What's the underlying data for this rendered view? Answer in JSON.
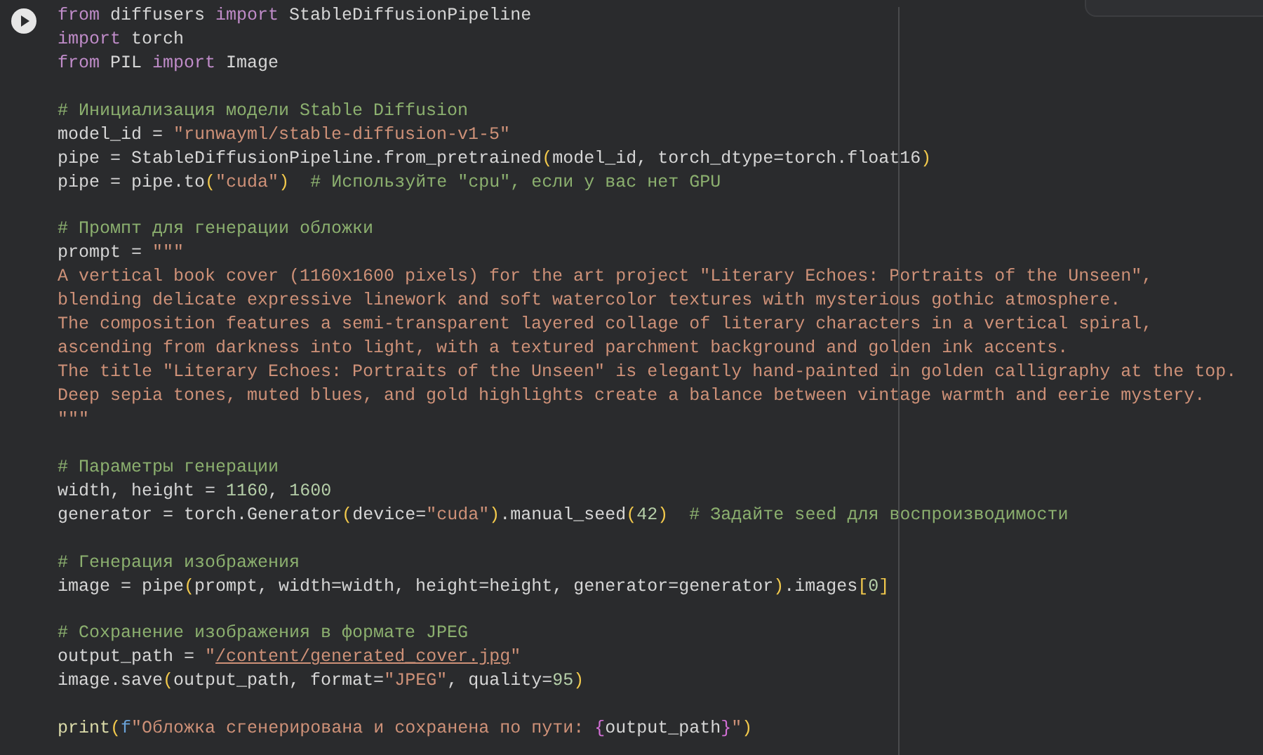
{
  "code_cell": {
    "lines": [
      {
        "kind": "code",
        "tokens": [
          {
            "kind": "keyword",
            "text": "from"
          },
          {
            "kind": "plain",
            "text": " diffusers "
          },
          {
            "kind": "keyword",
            "text": "import"
          },
          {
            "kind": "plain",
            "text": " StableDiffusionPipeline"
          }
        ]
      },
      {
        "kind": "code",
        "tokens": [
          {
            "kind": "keyword",
            "text": "import"
          },
          {
            "kind": "plain",
            "text": " torch"
          }
        ]
      },
      {
        "kind": "code",
        "tokens": [
          {
            "kind": "keyword",
            "text": "from"
          },
          {
            "kind": "plain",
            "text": " PIL "
          },
          {
            "kind": "keyword",
            "text": "import"
          },
          {
            "kind": "plain",
            "text": " Image"
          }
        ]
      },
      {
        "kind": "blank"
      },
      {
        "kind": "code",
        "tokens": [
          {
            "kind": "comment",
            "text": "# Инициализация модели Stable Diffusion"
          }
        ]
      },
      {
        "kind": "code",
        "tokens": [
          {
            "kind": "plain",
            "text": "model_id = "
          },
          {
            "kind": "string",
            "text": "\"runwayml/stable-diffusion-v1-5\""
          }
        ]
      },
      {
        "kind": "code",
        "tokens": [
          {
            "kind": "plain",
            "text": "pipe = StableDiffusionPipeline.from_pretrained"
          },
          {
            "kind": "bracket",
            "text": "("
          },
          {
            "kind": "plain",
            "text": "model_id, torch_dtype=torch.float16"
          },
          {
            "kind": "bracket",
            "text": ")"
          }
        ]
      },
      {
        "kind": "code",
        "tokens": [
          {
            "kind": "plain",
            "text": "pipe = pipe.to"
          },
          {
            "kind": "bracket",
            "text": "("
          },
          {
            "kind": "string",
            "text": "\"cuda\""
          },
          {
            "kind": "bracket",
            "text": ")"
          },
          {
            "kind": "comment",
            "text": "  # Используйте \"cpu\", если у вас нет GPU"
          }
        ]
      },
      {
        "kind": "blank"
      },
      {
        "kind": "code",
        "tokens": [
          {
            "kind": "comment",
            "text": "# Промпт для генерации обложки"
          }
        ]
      },
      {
        "kind": "code",
        "tokens": [
          {
            "kind": "plain",
            "text": "prompt = "
          },
          {
            "kind": "string",
            "text": "\"\"\""
          }
        ]
      },
      {
        "kind": "code",
        "tokens": [
          {
            "kind": "string",
            "text": "A vertical book cover (1160x1600 pixels) for the art project \"Literary Echoes: Portraits of the Unseen\","
          }
        ]
      },
      {
        "kind": "code",
        "tokens": [
          {
            "kind": "string",
            "text": "blending delicate expressive linework and soft watercolor textures with mysterious gothic atmosphere."
          }
        ]
      },
      {
        "kind": "code",
        "tokens": [
          {
            "kind": "string",
            "text": "The composition features a semi-transparent layered collage of literary characters in a vertical spiral,"
          }
        ]
      },
      {
        "kind": "code",
        "tokens": [
          {
            "kind": "string",
            "text": "ascending from darkness into light, with a textured parchment background and golden ink accents."
          }
        ]
      },
      {
        "kind": "code",
        "tokens": [
          {
            "kind": "string",
            "text": "The title \"Literary Echoes: Portraits of the Unseen\" is elegantly hand-painted in golden calligraphy at the top."
          }
        ]
      },
      {
        "kind": "code",
        "tokens": [
          {
            "kind": "string",
            "text": "Deep sepia tones, muted blues, and gold highlights create a balance between vintage warmth and eerie mystery."
          }
        ]
      },
      {
        "kind": "code",
        "tokens": [
          {
            "kind": "string",
            "text": "\"\"\""
          }
        ]
      },
      {
        "kind": "blank"
      },
      {
        "kind": "code",
        "tokens": [
          {
            "kind": "comment",
            "text": "# Параметры генерации"
          }
        ]
      },
      {
        "kind": "code",
        "tokens": [
          {
            "kind": "plain",
            "text": "width, height = "
          },
          {
            "kind": "number",
            "text": "1160"
          },
          {
            "kind": "plain",
            "text": ", "
          },
          {
            "kind": "number",
            "text": "1600"
          }
        ]
      },
      {
        "kind": "code",
        "tokens": [
          {
            "kind": "plain",
            "text": "generator = torch.Generator"
          },
          {
            "kind": "bracket",
            "text": "("
          },
          {
            "kind": "plain",
            "text": "device="
          },
          {
            "kind": "string",
            "text": "\"cuda\""
          },
          {
            "kind": "bracket",
            "text": ")"
          },
          {
            "kind": "plain",
            "text": ".manual_seed"
          },
          {
            "kind": "bracket",
            "text": "("
          },
          {
            "kind": "number",
            "text": "42"
          },
          {
            "kind": "bracket",
            "text": ")"
          },
          {
            "kind": "comment",
            "text": "  # Задайте seed для воспроизводимости"
          }
        ]
      },
      {
        "kind": "blank"
      },
      {
        "kind": "code",
        "tokens": [
          {
            "kind": "comment",
            "text": "# Генерация изображения"
          }
        ]
      },
      {
        "kind": "code",
        "tokens": [
          {
            "kind": "plain",
            "text": "image = pipe"
          },
          {
            "kind": "bracket",
            "text": "("
          },
          {
            "kind": "plain",
            "text": "prompt, width=width, height=height, generator=generator"
          },
          {
            "kind": "bracket",
            "text": ")"
          },
          {
            "kind": "plain",
            "text": ".images"
          },
          {
            "kind": "bracket",
            "text": "["
          },
          {
            "kind": "number",
            "text": "0"
          },
          {
            "kind": "bracket",
            "text": "]"
          }
        ]
      },
      {
        "kind": "blank"
      },
      {
        "kind": "code",
        "tokens": [
          {
            "kind": "comment",
            "text": "# Сохранение изображения в формате JPEG"
          }
        ]
      },
      {
        "kind": "code",
        "tokens": [
          {
            "kind": "plain",
            "text": "output_path = "
          },
          {
            "kind": "string",
            "text": "\""
          },
          {
            "kind": "link",
            "text": "/content/generated_cover.jpg"
          },
          {
            "kind": "string",
            "text": "\""
          }
        ]
      },
      {
        "kind": "code",
        "tokens": [
          {
            "kind": "plain",
            "text": "image.save"
          },
          {
            "kind": "bracket",
            "text": "("
          },
          {
            "kind": "plain",
            "text": "output_path, format="
          },
          {
            "kind": "string",
            "text": "\"JPEG\""
          },
          {
            "kind": "plain",
            "text": ", quality="
          },
          {
            "kind": "number",
            "text": "95"
          },
          {
            "kind": "bracket",
            "text": ")"
          }
        ]
      },
      {
        "kind": "blank"
      },
      {
        "kind": "code",
        "tokens": [
          {
            "kind": "builtin",
            "text": "print"
          },
          {
            "kind": "bracket",
            "text": "("
          },
          {
            "kind": "prefix",
            "text": "f"
          },
          {
            "kind": "string",
            "text": "\"Обложка сгенерирована и сохранена по пути: "
          },
          {
            "kind": "brace",
            "text": "{"
          },
          {
            "kind": "plain",
            "text": "output_path"
          },
          {
            "kind": "brace",
            "text": "}"
          },
          {
            "kind": "string",
            "text": "\""
          },
          {
            "kind": "bracket",
            "text": ")"
          }
        ]
      }
    ]
  }
}
